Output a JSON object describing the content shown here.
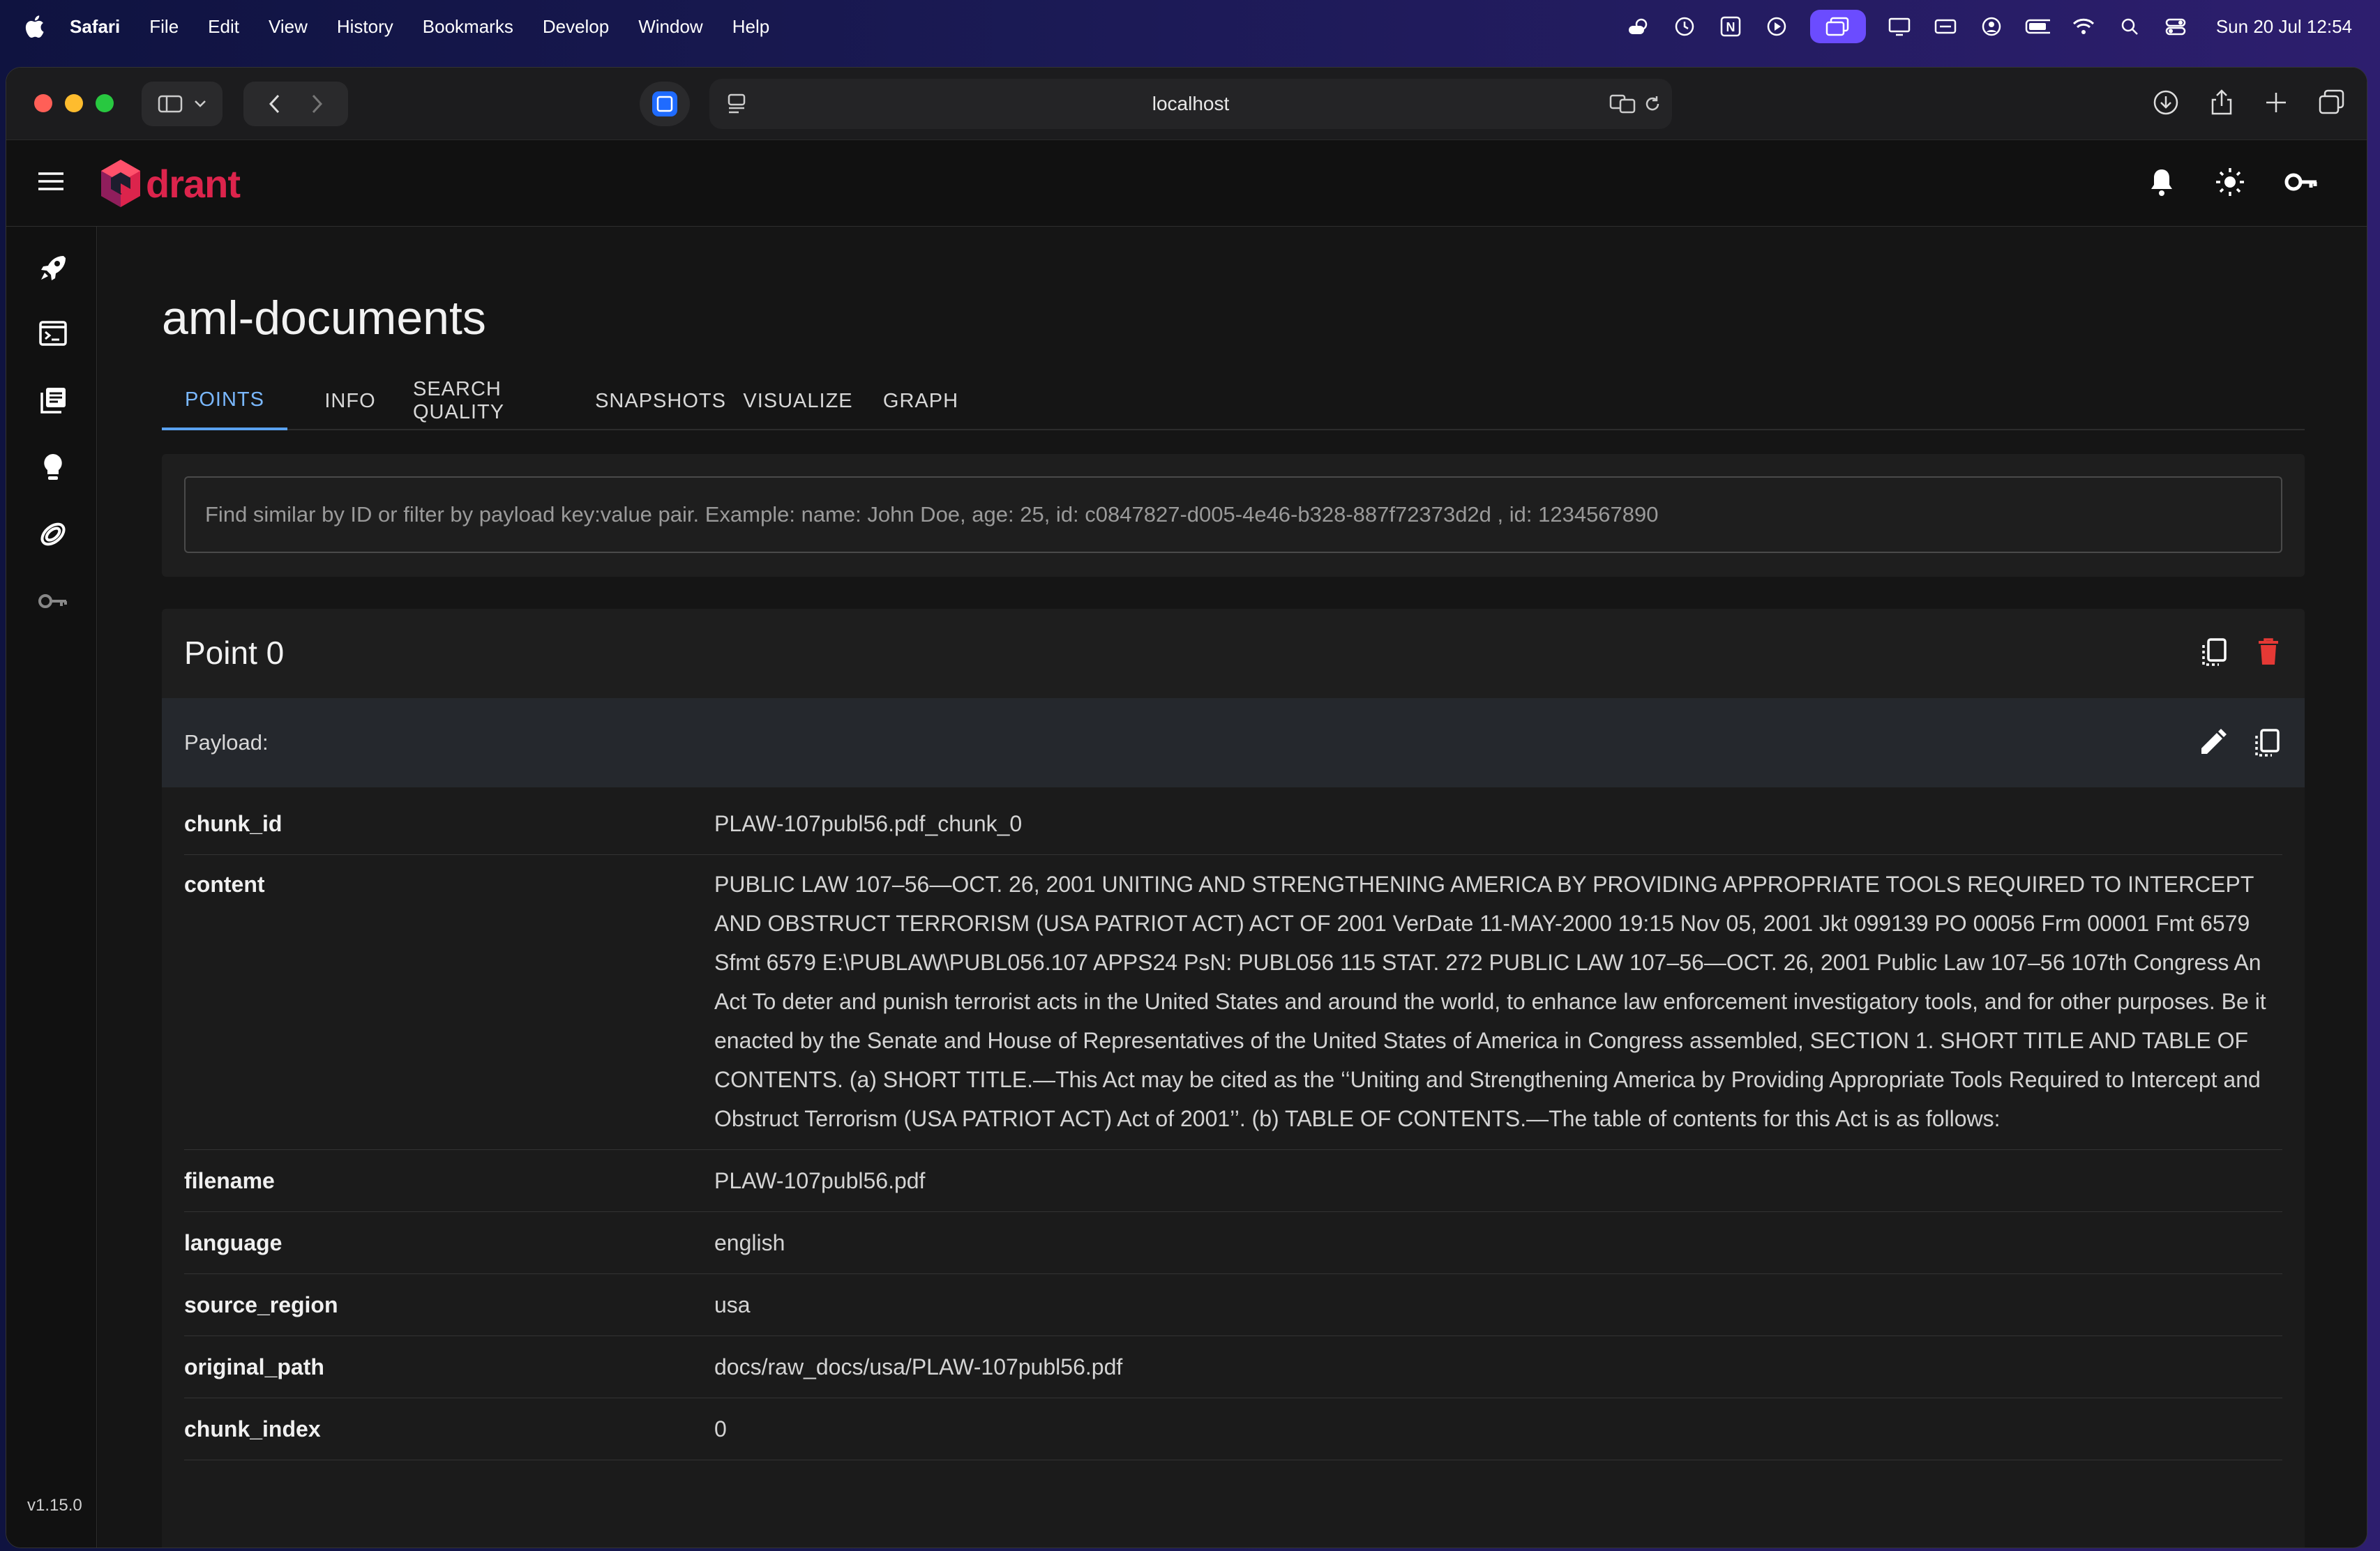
{
  "menubar": {
    "items": [
      "Safari",
      "File",
      "Edit",
      "View",
      "History",
      "Bookmarks",
      "Develop",
      "Window",
      "Help"
    ],
    "clock": "Sun 20 Jul  12:54"
  },
  "browser": {
    "url": "localhost"
  },
  "app": {
    "logo_text": "drant",
    "version": "v1.15.0"
  },
  "page": {
    "title": "aml-documents",
    "tabs": [
      "POINTS",
      "INFO",
      "SEARCH QUALITY",
      "SNAPSHOTS",
      "VISUALIZE",
      "GRAPH"
    ],
    "active_tab": "POINTS",
    "search_placeholder": "Find similar by ID or filter by payload key:value pair. Example: name: John Doe, age: 25, id: c0847827-d005-4e46-b328-887f72373d2d , id: 1234567890"
  },
  "point": {
    "title": "Point 0",
    "payload_label": "Payload:",
    "fields": [
      {
        "key": "chunk_id",
        "value": "PLAW-107publ56.pdf_chunk_0"
      },
      {
        "key": "content",
        "value": "PUBLIC LAW 107–56—OCT. 26, 2001 UNITING AND STRENGTHENING AMERICA BY PROVIDING APPROPRIATE TOOLS REQUIRED TO INTERCEPT AND OBSTRUCT TERRORISM (USA PATRIOT ACT) ACT OF 2001 VerDate 11-MAY-2000 19:15 Nov 05, 2001 Jkt 099139 PO 00056 Frm 00001 Fmt 6579 Sfmt 6579 E:\\PUBLAW\\PUBL056.107 APPS24 PsN: PUBL056 115 STAT. 272 PUBLIC LAW 107–56—OCT. 26, 2001 Public Law 107–56 107th Congress An Act To deter and punish terrorist acts in the United States and around the world, to enhance law enforcement investigatory tools, and for other purposes. Be it enacted by the Senate and House of Representatives of the United States of America in Congress assembled, SECTION 1. SHORT TITLE AND TABLE OF CONTENTS. (a) SHORT TITLE.—This Act may be cited as the ‘‘Uniting and Strengthening America by Providing Appropriate Tools Required to Intercept and Obstruct Terrorism (USA PATRIOT ACT) Act of 2001’’. (b) TABLE OF CONTENTS.—The table of contents for this Act is as follows:"
      },
      {
        "key": "filename",
        "value": "PLAW-107publ56.pdf"
      },
      {
        "key": "language",
        "value": "english"
      },
      {
        "key": "source_region",
        "value": "usa"
      },
      {
        "key": "original_path",
        "value": "docs/raw_docs/usa/PLAW-107publ56.pdf"
      },
      {
        "key": "chunk_index",
        "value": "0"
      }
    ]
  },
  "colors": {
    "accent": "#5aa2f0",
    "brand": "#dc244c",
    "delete": "#e53935"
  }
}
